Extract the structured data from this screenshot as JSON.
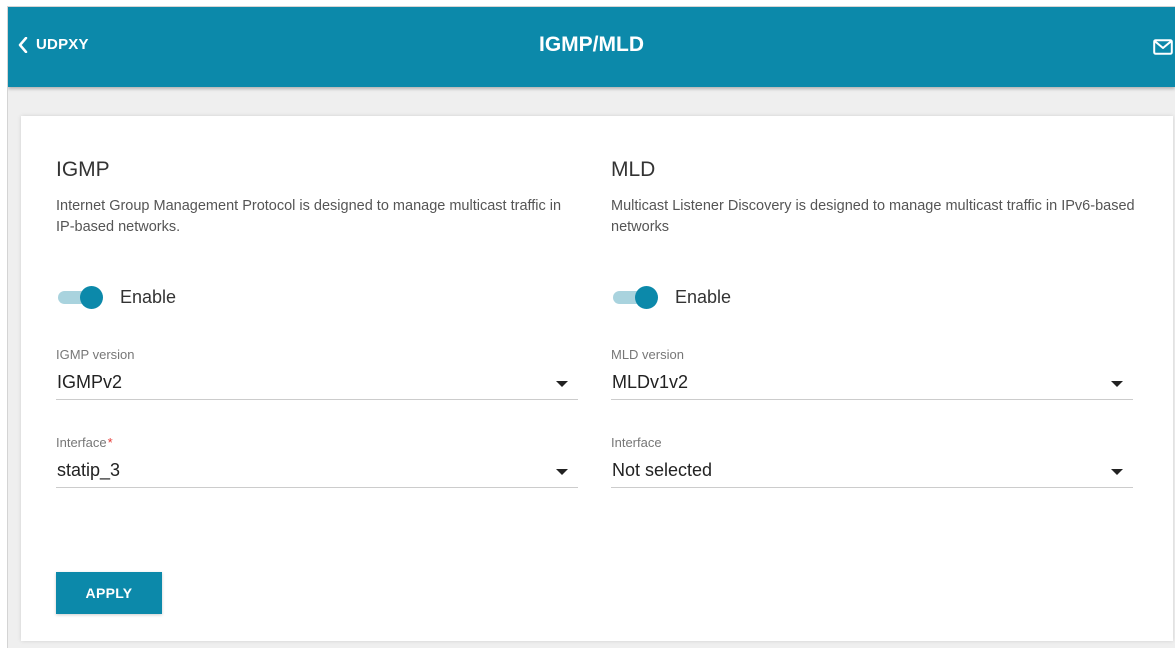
{
  "header": {
    "back_label": "UDPXY",
    "title": "IGMP/MLD",
    "mail_icon": "mail-icon",
    "background": "#0c89aa"
  },
  "igmp": {
    "title": "IGMP",
    "description": "Internet Group Management Protocol is designed to manage multicast traffic in IP-based networks.",
    "enable_label": "Enable",
    "enabled": true,
    "version_label": "IGMP version",
    "version_value": "IGMPv2",
    "interface_label": "Interface",
    "interface_required_mark": "*",
    "interface_value": "statip_3"
  },
  "mld": {
    "title": "MLD",
    "description": "Multicast Listener Discovery is designed to manage multicast traffic in IPv6-based networks",
    "enable_label": "Enable",
    "enabled": true,
    "version_label": "MLD version",
    "version_value": "MLDv1v2",
    "interface_label": "Interface",
    "interface_value": "Not selected"
  },
  "actions": {
    "apply_label": "APPLY"
  },
  "colors": {
    "accent": "#0c89aa",
    "toggle_track": "#a9d3de",
    "required": "#e53935"
  }
}
